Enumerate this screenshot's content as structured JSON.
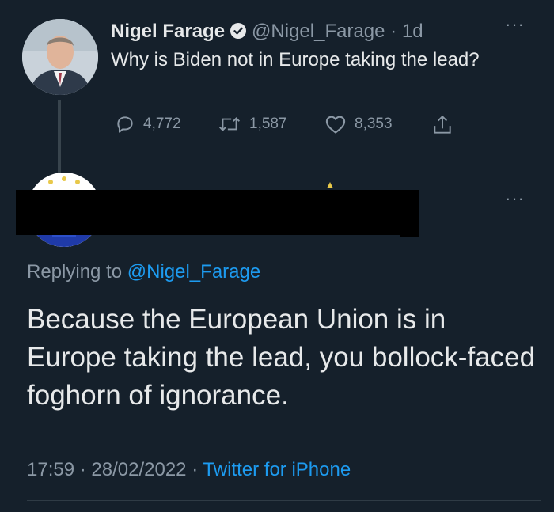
{
  "tweet": {
    "author_name": "Nigel Farage",
    "author_handle": "@Nigel_Farage",
    "separator": "·",
    "age": "1d",
    "text": "Why is Biden not in Europe taking the lead?",
    "replies": "4,772",
    "retweets": "1,587",
    "likes": "8,353",
    "more_icon": "···"
  },
  "reply": {
    "replying_prefix": "Replying to",
    "replying_handle": "@Nigel_Farage",
    "text": "Because the European Union is in Europe taking the lead, you bollock-faced foghorn of ignorance.",
    "time": "17:59",
    "separator": "·",
    "date": "28/02/2022",
    "source": "Twitter for iPhone",
    "more_icon": "···"
  },
  "colors": {
    "background": "#15202b",
    "primary_text": "#e7e9ea",
    "secondary_text": "#8b98a5",
    "link": "#1d9bf0",
    "redaction": "#000000"
  },
  "icons": [
    "verified-badge-icon",
    "reply-icon",
    "retweet-icon",
    "like-icon",
    "share-icon",
    "more-icon"
  ]
}
